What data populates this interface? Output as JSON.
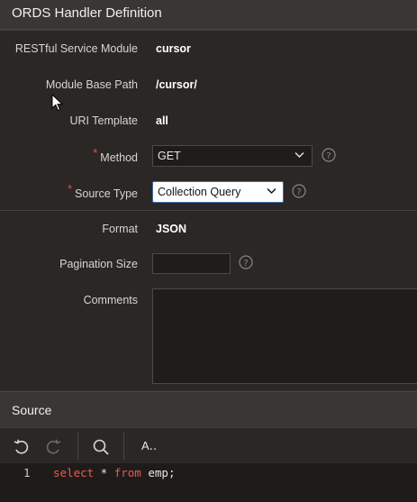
{
  "region": {
    "title": "ORDS Handler Definition"
  },
  "fields": {
    "module": {
      "label": "RESTful Service Module",
      "value": "cursor"
    },
    "base_path": {
      "label": "Module Base Path",
      "value": "/cursor/"
    },
    "uri_template": {
      "label": "URI Template",
      "value": "all"
    },
    "method": {
      "required": "*",
      "label": "Method",
      "value": "GET"
    },
    "source_type": {
      "required": "*",
      "label": "Source Type",
      "value": "Collection Query"
    },
    "format": {
      "label": "Format",
      "value": "JSON"
    },
    "pagination_size": {
      "label": "Pagination Size",
      "value": ""
    },
    "comments": {
      "label": "Comments",
      "value": ""
    }
  },
  "source": {
    "title": "Source",
    "toolbar": {
      "font_label": "A‥"
    },
    "editor": {
      "line_number": "1",
      "code": {
        "kw1": "select",
        "mid1": " * ",
        "kw2": "from",
        "rest": " emp;"
      }
    }
  },
  "icons": {
    "help": "help-icon",
    "undo": "undo-icon",
    "redo": "redo-icon",
    "search": "search-icon",
    "chevron": "chevron-down-icon",
    "pointer": "mouse-pointer-icon"
  },
  "colors": {
    "accent_required": "#e5534b",
    "keyword": "#f0584c",
    "focus_border": "#3b6fb0"
  }
}
